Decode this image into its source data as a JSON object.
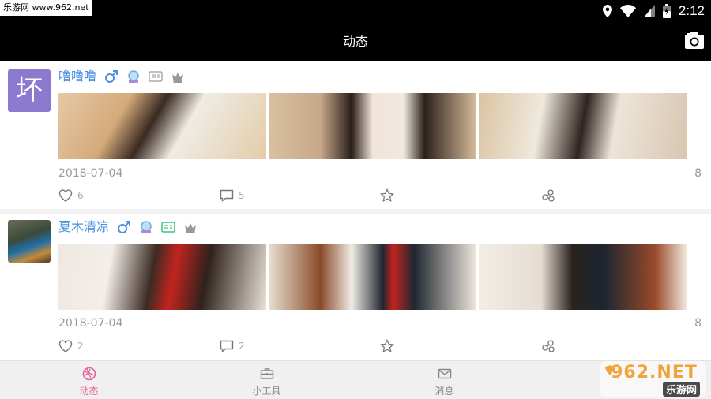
{
  "status_bar": {
    "watermark": "乐游网 www.962.net",
    "time": "2:12"
  },
  "header": {
    "title": "动态",
    "camera_icon": "camera-icon"
  },
  "posts": [
    {
      "avatar_char": "坏",
      "username": "噜噜噜",
      "badges": [
        "male-icon",
        "vip-badge-icon",
        "id-card-icon",
        "crown-icon"
      ],
      "date": "2018-07-04",
      "right_count": "8",
      "likes": "6",
      "comments": "5"
    },
    {
      "avatar_char": "",
      "username": "夏木清凉",
      "badges": [
        "male-icon",
        "vip-badge-icon",
        "id-card-icon",
        "crown-icon"
      ],
      "date": "2018-07-04",
      "right_count": "8",
      "likes": "2",
      "comments": "2"
    }
  ],
  "bottom_nav": {
    "items": [
      {
        "label": "动态",
        "icon": "dynamic-icon",
        "active": true
      },
      {
        "label": "小工具",
        "icon": "toolbox-icon",
        "active": false
      },
      {
        "label": "消息",
        "icon": "mail-icon",
        "active": false
      }
    ]
  },
  "watermark_brand": {
    "main": "962.NET",
    "sub": "乐游网"
  },
  "colors": {
    "accent_blue": "#4a90e2",
    "active_pink": "#e8609a",
    "header_bg": "#000000"
  }
}
